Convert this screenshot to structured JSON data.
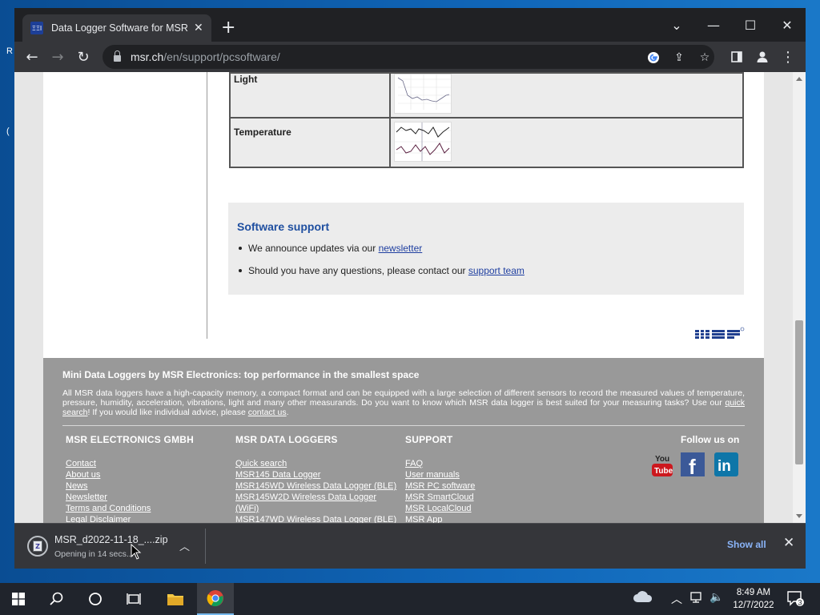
{
  "browser": {
    "tab_title": "Data Logger Software for MSR Da",
    "favicon_text": "ΞΞΙ",
    "url_domain": "msr.ch",
    "url_path": "/en/support/pcsoftware/"
  },
  "sensor_table": {
    "rows": [
      {
        "name": "Light"
      },
      {
        "name": "Temperature"
      }
    ]
  },
  "support": {
    "heading": "Software support",
    "item1_text": "We announce updates via our ",
    "item1_link": "newsletter",
    "item2_text": "Should you have any questions, please contact our ",
    "item2_link": "support team"
  },
  "footer": {
    "headline": "Mini Data Loggers by MSR Electronics: top performance in the smallest space",
    "intro_text_1": "All MSR data loggers have a high-capacity memory, a compact format and can be equipped with a large selection of different sensors to record the measured values of temperature, pressure, humidity, acceleration, vibrations, light and many other measurands. Do you want to know which MSR data logger is best suited for your measuring tasks? Use our ",
    "intro_link_1": "quick search",
    "intro_text_2": "! If you would like individual advice, please ",
    "intro_link_2": "contact us",
    "intro_text_3": ".",
    "col1": {
      "heading": "MSR ELECTRONICS GMBH",
      "links": [
        "Contact",
        "About us",
        "News",
        "Newsletter",
        "Terms and Conditions",
        "Legal Disclaimer"
      ]
    },
    "col2": {
      "heading": "MSR DATA LOGGERS",
      "links": [
        "Quick search",
        "MSR145 Data Logger",
        "MSR145WD Wireless Data Logger (BLE)",
        "MSR145W2D Wireless Data Logger",
        "(WiFi)",
        "MSR147WD Wireless Data Logger (BLE)"
      ]
    },
    "col3": {
      "heading": "SUPPORT",
      "links": [
        "FAQ",
        "User manuals",
        "MSR PC software",
        "MSR SmartCloud",
        "MSR LocalCloud",
        "MSR App"
      ]
    },
    "follow_label": "Follow us on",
    "youtube_text_1": "You",
    "youtube_text_2": "Tube",
    "facebook_text": "f",
    "linkedin_text": "in"
  },
  "download": {
    "filename": "MSR_d2022-11-18_....zip",
    "status": "Opening in 14 secs...",
    "show_all": "Show all"
  },
  "taskbar": {
    "time": "8:49 AM",
    "date": "12/7/2022",
    "notification_count": "3"
  },
  "desktop": {
    "fragment_r": "R",
    "fragment_c": "("
  },
  "colors": {
    "link": "#1f3fa0",
    "support_heading": "#1f4fa0",
    "footer_bg": "#999999",
    "chrome_dark": "#202124",
    "show_all": "#8ab4f8"
  }
}
